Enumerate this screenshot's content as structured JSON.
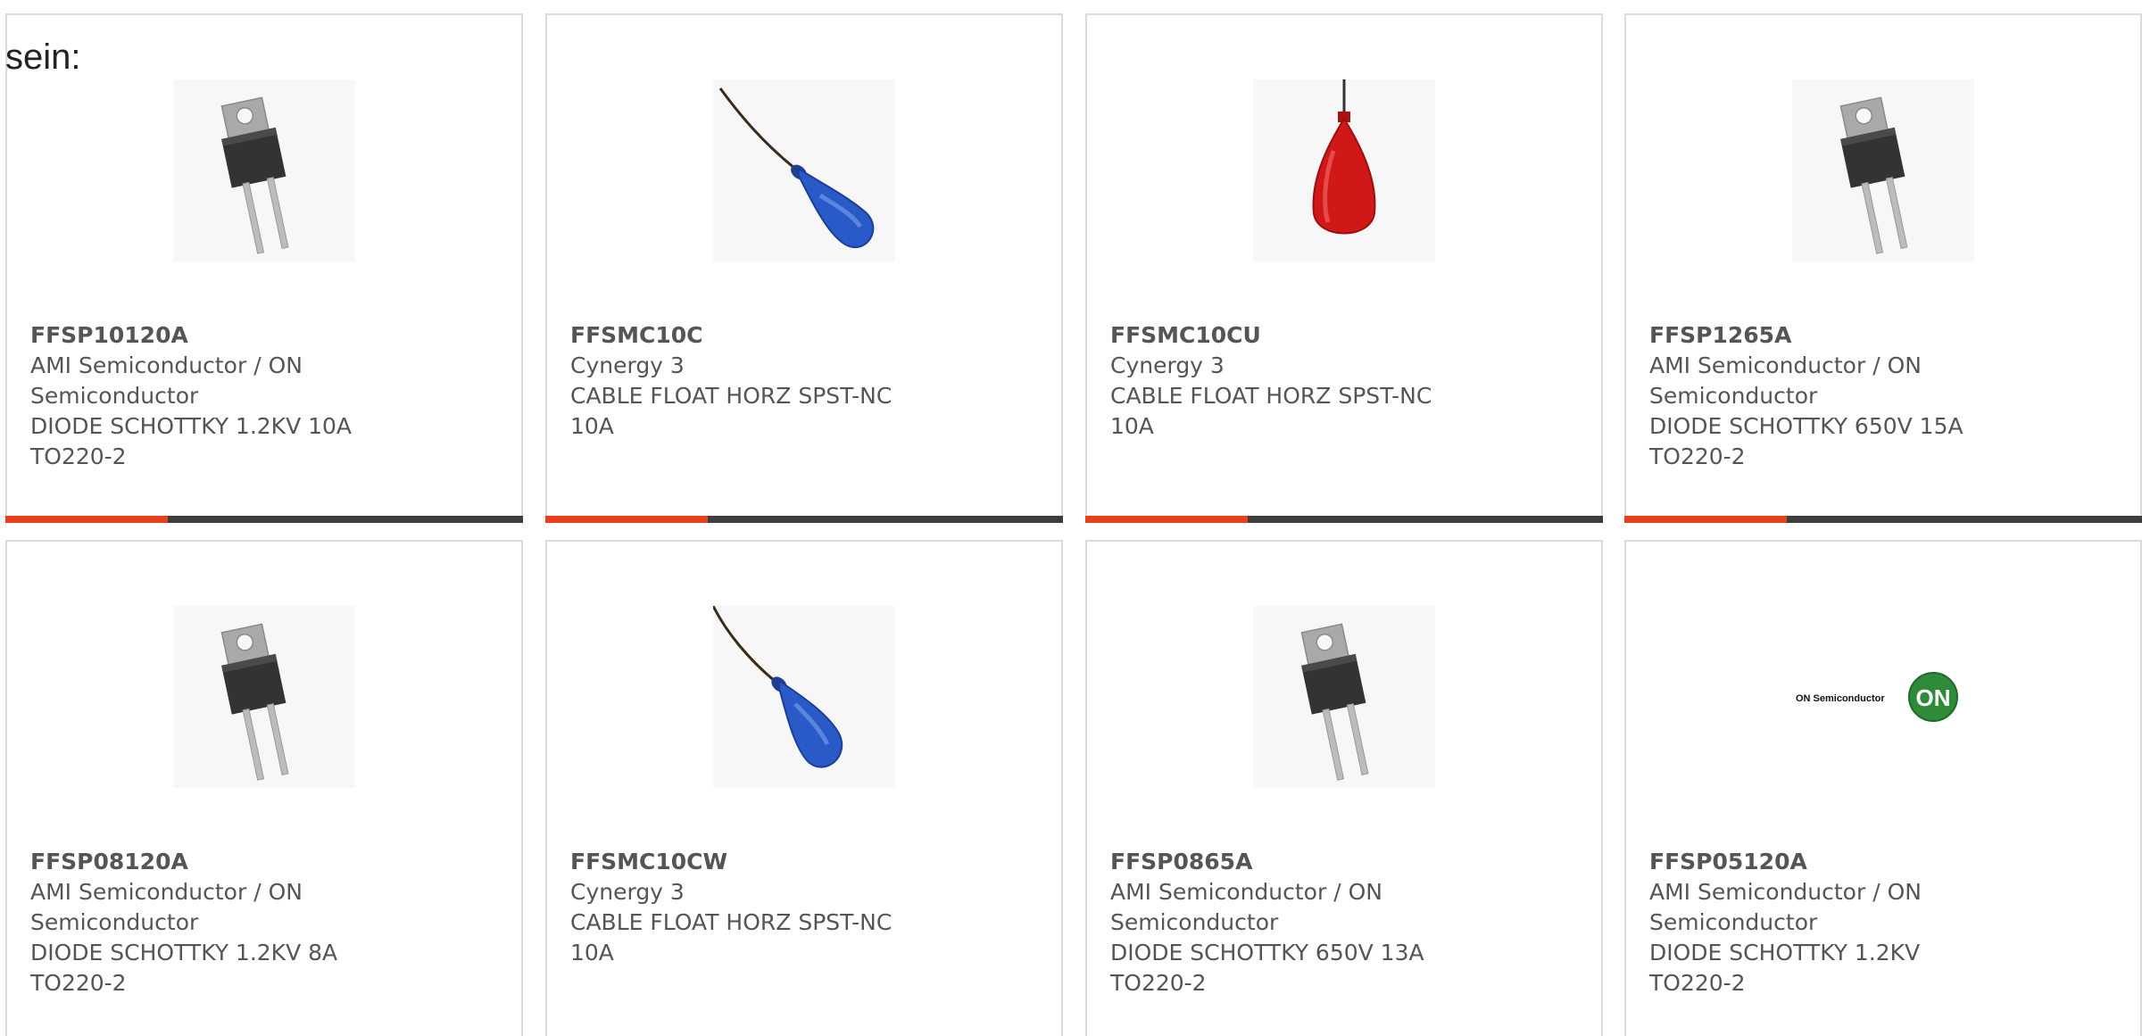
{
  "intro_text": "sein:",
  "colors": {
    "accent": "#e8401c",
    "bar": "#3d3d3d",
    "text": "#555555",
    "border": "#dcdcdc"
  },
  "products": [
    {
      "part_number": "FFSP10120A",
      "manufacturer": "AMI Semiconductor / ON Semiconductor",
      "description": "DIODE SCHOTTKY 1.2KV 10A TO220-2",
      "image": "to220-diode-image"
    },
    {
      "part_number": "FFSMC10C",
      "manufacturer": "Cynergy 3",
      "description": "CABLE FLOAT HORZ SPST-NC 10A",
      "image": "blue-float-switch-image"
    },
    {
      "part_number": "FFSMC10CU",
      "manufacturer": "Cynergy 3",
      "description": "CABLE FLOAT HORZ SPST-NC 10A",
      "image": "red-float-switch-image"
    },
    {
      "part_number": "FFSP1265A",
      "manufacturer": "AMI Semiconductor / ON Semiconductor",
      "description": "DIODE SCHOTTKY 650V 15A TO220-2",
      "image": "to220-diode-image"
    },
    {
      "part_number": "FFSP08120A",
      "manufacturer": "AMI Semiconductor / ON Semiconductor",
      "description": "DIODE SCHOTTKY 1.2KV 8A TO220-2",
      "image": "to220-diode-image"
    },
    {
      "part_number": "FFSMC10CW",
      "manufacturer": "Cynergy 3",
      "description": "CABLE FLOAT HORZ SPST-NC 10A",
      "image": "blue-float-switch-image"
    },
    {
      "part_number": "FFSP0865A",
      "manufacturer": "AMI Semiconductor / ON Semiconductor",
      "description": "DIODE SCHOTTKY 650V 13A TO220-2",
      "image": "to220-diode-image"
    },
    {
      "part_number": "FFSP05120A",
      "manufacturer": "AMI Semiconductor / ON Semiconductor",
      "description": "DIODE SCHOTTKY 1.2KV TO220-2",
      "image": "on-semiconductor-logo-image",
      "logo_text": "ON Semiconductor",
      "logo_badge": "ON"
    }
  ]
}
